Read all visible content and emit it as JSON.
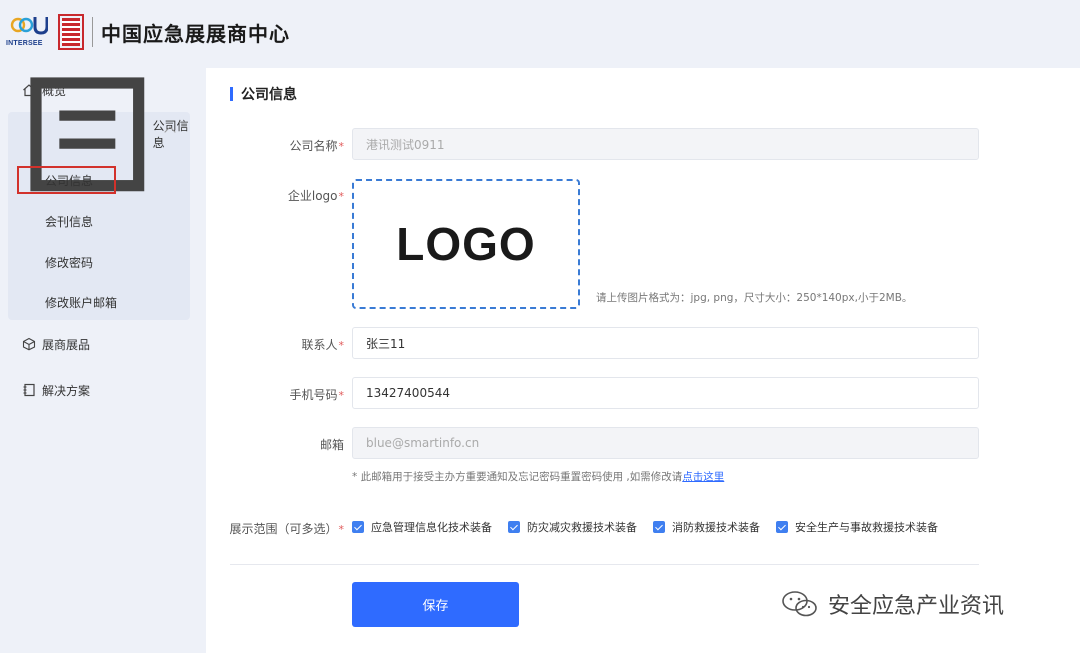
{
  "header": {
    "logo_word": "INTERSEE",
    "brand_title": "中国应急展展商中心"
  },
  "sidebar": {
    "overview": "概览",
    "company_group": "公司信息",
    "sub_items": [
      "公司信息",
      "会刊信息",
      "修改密码",
      "修改账户邮箱"
    ],
    "exhibits": "展商展品",
    "solutions": "解决方案"
  },
  "form": {
    "section_title": "公司信息",
    "company_name_label": "公司名称",
    "company_name_value": "港讯测试0911",
    "logo_label": "企业logo",
    "logo_text": "LOGO",
    "upload_hint": "请上传图片格式为：jpg, png，尺寸大小：250*140px,小于2MB。",
    "contact_label": "联系人",
    "contact_value": "张三11",
    "phone_label": "手机号码",
    "phone_value": "13427400544",
    "email_label": "邮箱",
    "email_value": "blue@smartinfo.cn",
    "note_text": "* 此邮箱用于接受主办方重要通知及忘记密码重置密码使用 ,如需修改请",
    "note_link": "点击这里",
    "scope_label": "展示范围（可多选）",
    "scope_options": [
      "应急管理信息化技术装备",
      "防灾减灾救援技术装备",
      "消防救援技术装备",
      "安全生产与事故救援技术装备"
    ],
    "save_label": "保存",
    "required_mark": "*"
  },
  "watermark": {
    "text": "安全应急产业资讯"
  },
  "colors": {
    "accent": "#2f6bff",
    "sidebar_bg": "#eef1f8",
    "highlight_border": "#d2312b"
  }
}
